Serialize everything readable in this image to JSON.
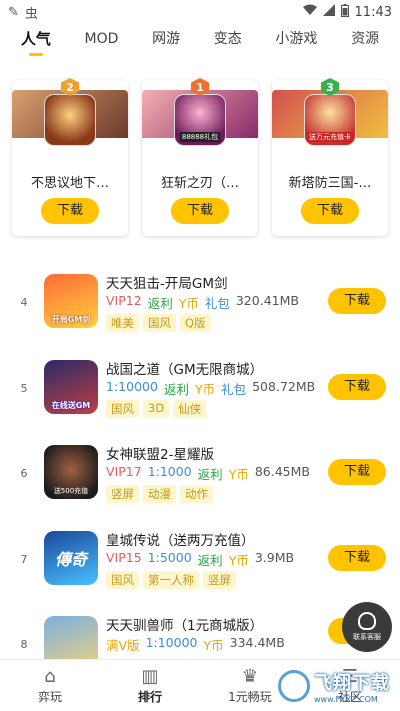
{
  "status": {
    "time": "11:43",
    "app_glyph": "虫"
  },
  "tabs": [
    {
      "label": "人气",
      "active": true
    },
    {
      "label": "MOD"
    },
    {
      "label": "网游"
    },
    {
      "label": "变态"
    },
    {
      "label": "小游戏"
    },
    {
      "label": "资源"
    }
  ],
  "top_cards": [
    {
      "rank": "2",
      "title": "不思议地下…",
      "download": "下载",
      "badge_color": "#f0a030",
      "banner": [
        "#d9a070",
        "#6b3a2a"
      ]
    },
    {
      "rank": "1",
      "title": "狂斩之刃（…",
      "download": "下载",
      "badge_color": "#f07030",
      "banner": [
        "#f4b0b0",
        "#8a2a6a"
      ],
      "icon_text": "88888礼包"
    },
    {
      "rank": "3",
      "title": "新塔防三国-…",
      "download": "下载",
      "badge_color": "#3ab050",
      "banner": [
        "#d45050",
        "#f0c040"
      ],
      "icon_text": "送万元充值卡"
    }
  ],
  "list": [
    {
      "rank": "4",
      "title": "天天狙击-开局GM剑",
      "meta": [
        {
          "t": "VIP12",
          "c": "#e85a5a"
        },
        {
          "t": "返利",
          "c": "#28a745"
        },
        {
          "t": "Y币",
          "c": "#e6a800"
        },
        {
          "t": "礼包",
          "c": "#3b8fd6"
        },
        {
          "t": "320.41MB",
          "c": "#555"
        }
      ],
      "tags": [
        "唯美",
        "国风",
        "Q版"
      ],
      "download": "下载",
      "icon_text": "开局GM剑",
      "icon_colors": [
        "#ff6a3a",
        "#ffd23a"
      ]
    },
    {
      "rank": "5",
      "title": "战国之道（GM无限商城）",
      "meta": [
        {
          "t": "1:10000",
          "c": "#3b8fd6"
        },
        {
          "t": "返利",
          "c": "#28a745"
        },
        {
          "t": "Y币",
          "c": "#e6a800"
        },
        {
          "t": "礼包",
          "c": "#3b8fd6"
        },
        {
          "t": "508.72MB",
          "c": "#555"
        }
      ],
      "tags": [
        "国风",
        "3D",
        "仙侠"
      ],
      "download": "下载",
      "icon_text": "在线送GM",
      "icon_colors": [
        "#2a2a6a",
        "#c04040"
      ]
    },
    {
      "rank": "6",
      "title": "女神联盟2-星耀版",
      "meta": [
        {
          "t": "VIP17",
          "c": "#e85a5a"
        },
        {
          "t": "1:1000",
          "c": "#3b8fd6"
        },
        {
          "t": "返利",
          "c": "#28a745"
        },
        {
          "t": "Y币",
          "c": "#e6a800"
        },
        {
          "t": "86.45MB",
          "c": "#555"
        }
      ],
      "tags": [
        "竖屏",
        "动漫",
        "动作"
      ],
      "download": "下载",
      "icon_text": "送500充值",
      "icon_colors": [
        "#3a2a2a",
        "#a06040"
      ]
    },
    {
      "rank": "7",
      "title": "皇城传说（送两万充值）",
      "meta": [
        {
          "t": "VIP15",
          "c": "#e85a5a"
        },
        {
          "t": "1:5000",
          "c": "#3b8fd6"
        },
        {
          "t": "返利",
          "c": "#28a745"
        },
        {
          "t": "Y币",
          "c": "#e6a800"
        },
        {
          "t": "3.9MB",
          "c": "#555"
        }
      ],
      "tags": [
        "国风",
        "第一人称",
        "竖屏"
      ],
      "download": "下载",
      "icon_text": "傳奇",
      "icon_colors": [
        "#1a4a9a",
        "#4ac0ff"
      ]
    },
    {
      "rank": "8",
      "title": "天天驯兽师（1元商城版）",
      "meta": [
        {
          "t": "满V版",
          "c": "#e6a800"
        },
        {
          "t": "1:10000",
          "c": "#3b8fd6"
        },
        {
          "t": "Y币",
          "c": "#e6a800"
        },
        {
          "t": "334.4MB",
          "c": "#555"
        }
      ],
      "tags": [],
      "download": "下载",
      "icon_text": "",
      "icon_colors": [
        "#7ab0e0",
        "#f0d080"
      ]
    }
  ],
  "float_service": {
    "label": "联系客服"
  },
  "bottom_nav": [
    {
      "label": "弈玩",
      "icon": "home-icon",
      "glyph": "⌂"
    },
    {
      "label": "排行",
      "icon": "ranking-icon",
      "glyph": "▥",
      "active": true
    },
    {
      "label": "1元畅玩",
      "icon": "crown-icon",
      "glyph": "♛"
    },
    {
      "label": "社区",
      "icon": "community-icon",
      "glyph": "☰"
    }
  ],
  "watermark": {
    "cn": "飞翔下载",
    "en": "www.FXXZ.COM"
  }
}
